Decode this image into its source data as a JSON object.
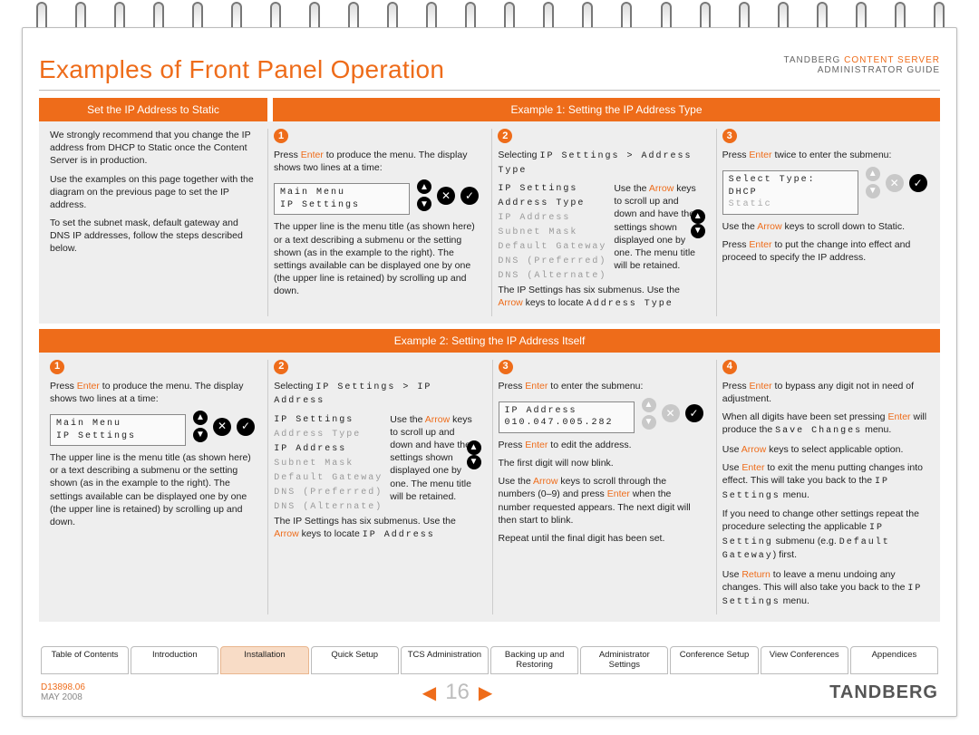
{
  "doc": {
    "brand": "TANDBERG",
    "product": "CONTENT SERVER",
    "guide": "ADMINISTRATOR GUIDE",
    "number": "D13898.06",
    "date": "MAY 2008",
    "page": "16"
  },
  "title": "Examples of Front Panel Operation",
  "section_a": {
    "left_tab": "Set the IP Address to Static",
    "right_tab": "Example 1: Setting the IP Address Type",
    "intro": {
      "p1": "We strongly recommend that you change the IP address from DHCP to Static once the Content Server is in production.",
      "p2": "Use the examples on this page together with the diagram on the previous page to set the IP address.",
      "p3": "To set the subnet mask, default gateway and DNS IP addresses, follow the steps described below."
    },
    "step1": {
      "num": "1",
      "p1a": "Press ",
      "p1b": "Enter",
      "p1c": " to produce the menu. The display shows two lines at a time:",
      "lcd1": "Main Menu",
      "lcd2": "IP Settings",
      "p2": "The upper line is the menu title (as shown here) or a text describing a submenu or the setting shown (as in the example to the right). The settings available can be displayed one by one (the upper line is retained) by scrolling up and down."
    },
    "step2": {
      "num": "2",
      "sel_a": "Selecting ",
      "sel_b": "IP Settings > Address Type",
      "menu": {
        "a": "IP Settings",
        "b": "Address Type",
        "c": "IP Address",
        "d": "Subnet Mask",
        "e": "Default Gateway",
        "f": "DNS (Preferred)",
        "g": "DNS (Alternate)"
      },
      "hint_a": "Use the ",
      "hint_b": "Arrow",
      "hint_c": " keys to scroll up and down and have the settings shown displayed one by one. The menu title will be retained.",
      "foot_a": "The IP Settings has six submenus. Use the ",
      "foot_b": "Arrow",
      "foot_c": " keys to locate ",
      "foot_d": "Address Type"
    },
    "step3": {
      "num": "3",
      "p1a": "Press ",
      "p1b": "Enter",
      "p1c": " twice to enter the submenu:",
      "lcd1": "Select Type:",
      "lcd2": "DHCP",
      "lcd3": "Static",
      "p2a": "Use the ",
      "p2b": "Arrow",
      "p2c": " keys to scroll down to Static.",
      "p3a": "Press ",
      "p3b": "Enter",
      "p3c": " to put the change into effect and proceed to specify the IP address."
    }
  },
  "section_b": {
    "banner": "Example 2: Setting the IP Address Itself",
    "s1": {
      "num": "1",
      "p1a": "Press ",
      "p1b": "Enter",
      "p1c": " to produce the menu. The display shows two lines at a time:",
      "lcd1": "Main Menu",
      "lcd2": "IP Settings",
      "p2": "The upper line is the menu title (as shown here) or a text describing a submenu or the setting shown (as in the example to the right). The settings available can be displayed one by one (the upper line is retained) by scrolling up and down."
    },
    "s2": {
      "num": "2",
      "sel_a": "Selecting ",
      "sel_b": "IP Settings > IP Address",
      "menu": {
        "a": "IP Settings",
        "b": "Address Type",
        "c": "IP Address",
        "d": "Subnet Mask",
        "e": "Default Gateway",
        "f": "DNS (Preferred)",
        "g": "DNS (Alternate)"
      },
      "hint_a": "Use the ",
      "hint_b": "Arrow",
      "hint_c": " keys to scroll up and down and have the settings shown displayed one by one. The menu title will be retained.",
      "foot_a": "The IP Settings has six submenus. Use the ",
      "foot_b": "Arrow",
      "foot_c": " keys to locate ",
      "foot_d": "IP Address"
    },
    "s3": {
      "num": "3",
      "p1a": "Press ",
      "p1b": "Enter",
      "p1c": " to enter the submenu:",
      "lcd1": "IP Address",
      "lcd2": "010.047.005.282",
      "p2a": "Press ",
      "p2b": "Enter",
      "p2c": " to edit the address.",
      "p3": "The first digit will now blink.",
      "p4a": "Use the ",
      "p4b": "Arrow",
      "p4c": " keys to scroll through the numbers (0–9) and press ",
      "p4d": "Enter",
      "p4e": " when the number requested appears. The next digit will then start to blink.",
      "p5": "Repeat until the final digit has been set."
    },
    "s4": {
      "num": "4",
      "p1a": "Press ",
      "p1b": "Enter",
      "p1c": " to bypass any digit not in need of adjustment.",
      "p2a": "When all digits have been set pressing ",
      "p2b": "Enter",
      "p2c": " will produce the ",
      "p2d": "Save Changes",
      "p2e": " menu.",
      "p3a": "Use ",
      "p3b": "Arrow",
      "p3c": " keys to select applicable option.",
      "p4a": "Use ",
      "p4b": "Enter",
      "p4c": " to exit the menu putting changes into effect. This will take you back to the ",
      "p4d": "IP Settings",
      "p4e": " menu.",
      "p5a": "If you need to change other settings repeat the procedure selecting the applicable ",
      "p5b": "IP Setting",
      "p5c": " submenu (e.g. ",
      "p5d": "Default Gateway",
      "p5e": ") first.",
      "p6a": "Use ",
      "p6b": "Return",
      "p6c": " to leave a menu undoing any changes. This will also take you back to the ",
      "p6d": "IP Settings",
      "p6e": " menu."
    }
  },
  "nav": {
    "t0": "Table of Contents",
    "t1": "Introduction",
    "t2": "Installation",
    "t3": "Quick Setup",
    "t4": "TCS Administration",
    "t5": "Backing up and Restoring",
    "t6": "Administrator Settings",
    "t7": "Conference Setup",
    "t8": "View Conferences",
    "t9": "Appendices"
  }
}
